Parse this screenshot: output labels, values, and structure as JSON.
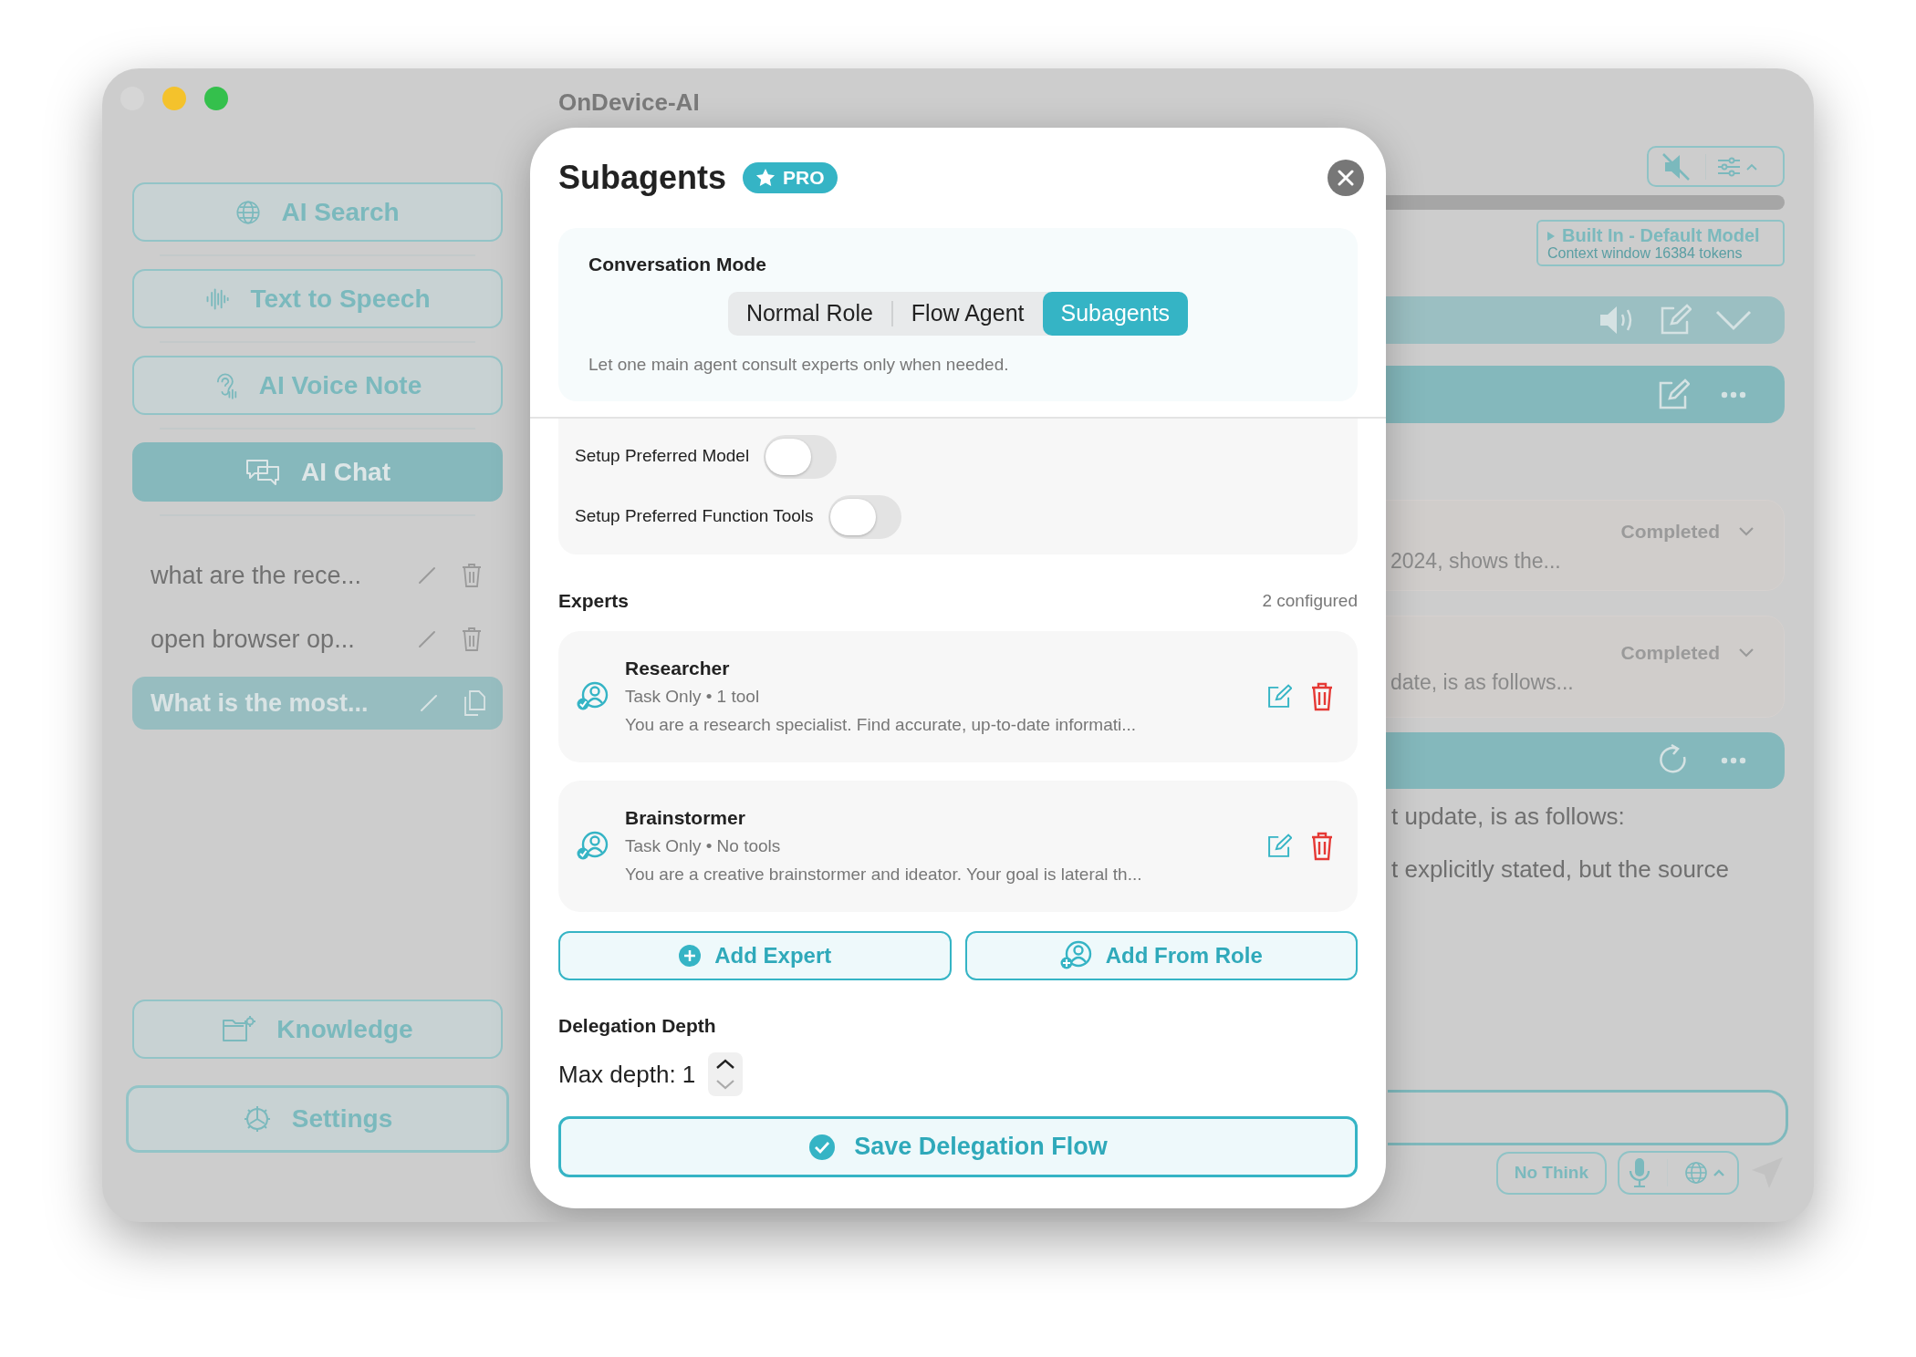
{
  "window": {
    "title": "OnDevice-AI"
  },
  "sidebar": {
    "nav": [
      {
        "label": "AI Search",
        "selected": false
      },
      {
        "label": "Text to Speech",
        "selected": false
      },
      {
        "label": "AI Voice Note",
        "selected": false
      },
      {
        "label": "AI Chat",
        "selected": true
      }
    ],
    "chats": [
      {
        "title": "what are the rece...",
        "selected": false
      },
      {
        "title": "open browser op...",
        "selected": false
      },
      {
        "title": "What is the most...",
        "selected": true
      }
    ],
    "bottom": [
      {
        "label": "Knowledge"
      },
      {
        "label": "Settings"
      }
    ]
  },
  "main": {
    "model": {
      "title": "Built In - Default Model",
      "subtitle": "Context window 16384 tokens"
    },
    "steps": [
      {
        "text": "2024, shows the...",
        "status": "Completed"
      },
      {
        "text": "date, is as follows...",
        "status": "Completed"
      }
    ],
    "answer_lines": [
      "t update, is as follows:",
      "t explicitly stated, but the source"
    ],
    "think_button": "No Think"
  },
  "modal": {
    "title": "Subagents",
    "badge": "PRO",
    "mode_title": "Conversation Mode",
    "modes": [
      {
        "label": "Normal Role",
        "selected": false
      },
      {
        "label": "Flow Agent",
        "selected": false
      },
      {
        "label": "Subagents",
        "selected": true
      }
    ],
    "mode_description": "Let one main agent consult experts only when needed.",
    "toggles": [
      {
        "label": "Setup Preferred Model",
        "on": false
      },
      {
        "label": "Setup Preferred Function Tools",
        "on": false
      }
    ],
    "experts_title": "Experts",
    "experts_count": "2 configured",
    "experts": [
      {
        "name": "Researcher",
        "meta": "Task Only • 1 tool",
        "description": "You are a research specialist. Find accurate, up-to-date informati..."
      },
      {
        "name": "Brainstormer",
        "meta": "Task Only • No tools",
        "description": "You are a creative brainstormer and ideator. Your goal is lateral th..."
      }
    ],
    "add_buttons": [
      "Add Expert",
      "Add From Role"
    ],
    "depth_title": "Delegation Depth",
    "depth_value": "Max depth: 1",
    "save_button": "Save Delegation Flow"
  }
}
